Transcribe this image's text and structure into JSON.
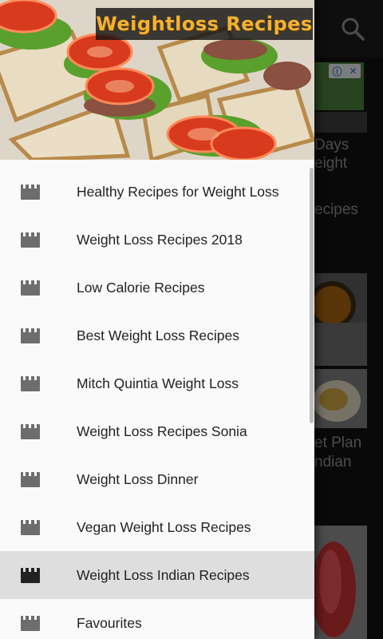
{
  "background": {
    "partial_texts": [
      "Days",
      "eight",
      "ecipes",
      "et Plan",
      "ndian"
    ]
  },
  "ad": {
    "badge_info": "ⓘ",
    "badge_close": "✕"
  },
  "drawer": {
    "header_title": "Weightloss Recipes",
    "items": [
      {
        "label": "Healthy Recipes for Weight Loss",
        "selected": false
      },
      {
        "label": "Weight Loss Recipes 2018",
        "selected": false
      },
      {
        "label": "Low Calorie Recipes",
        "selected": false
      },
      {
        "label": "Best Weight Loss Recipes",
        "selected": false
      },
      {
        "label": "Mitch Quintia Weight Loss",
        "selected": false
      },
      {
        "label": "Weight Loss Recipes Sonia",
        "selected": false
      },
      {
        "label": "Weight Loss Dinner",
        "selected": false
      },
      {
        "label": "Vegan Weight Loss Recipes",
        "selected": false
      },
      {
        "label": "Weight Loss Indian Recipes",
        "selected": true
      },
      {
        "label": "Favourites",
        "selected": false
      }
    ]
  },
  "colors": {
    "title_text": "#f2b233",
    "icon": "#6d6d6d",
    "icon_selected": "#222222",
    "selected_bg": "#dedede"
  },
  "icons": {
    "menu_item": "video-clapper-icon",
    "search": "search-icon"
  }
}
